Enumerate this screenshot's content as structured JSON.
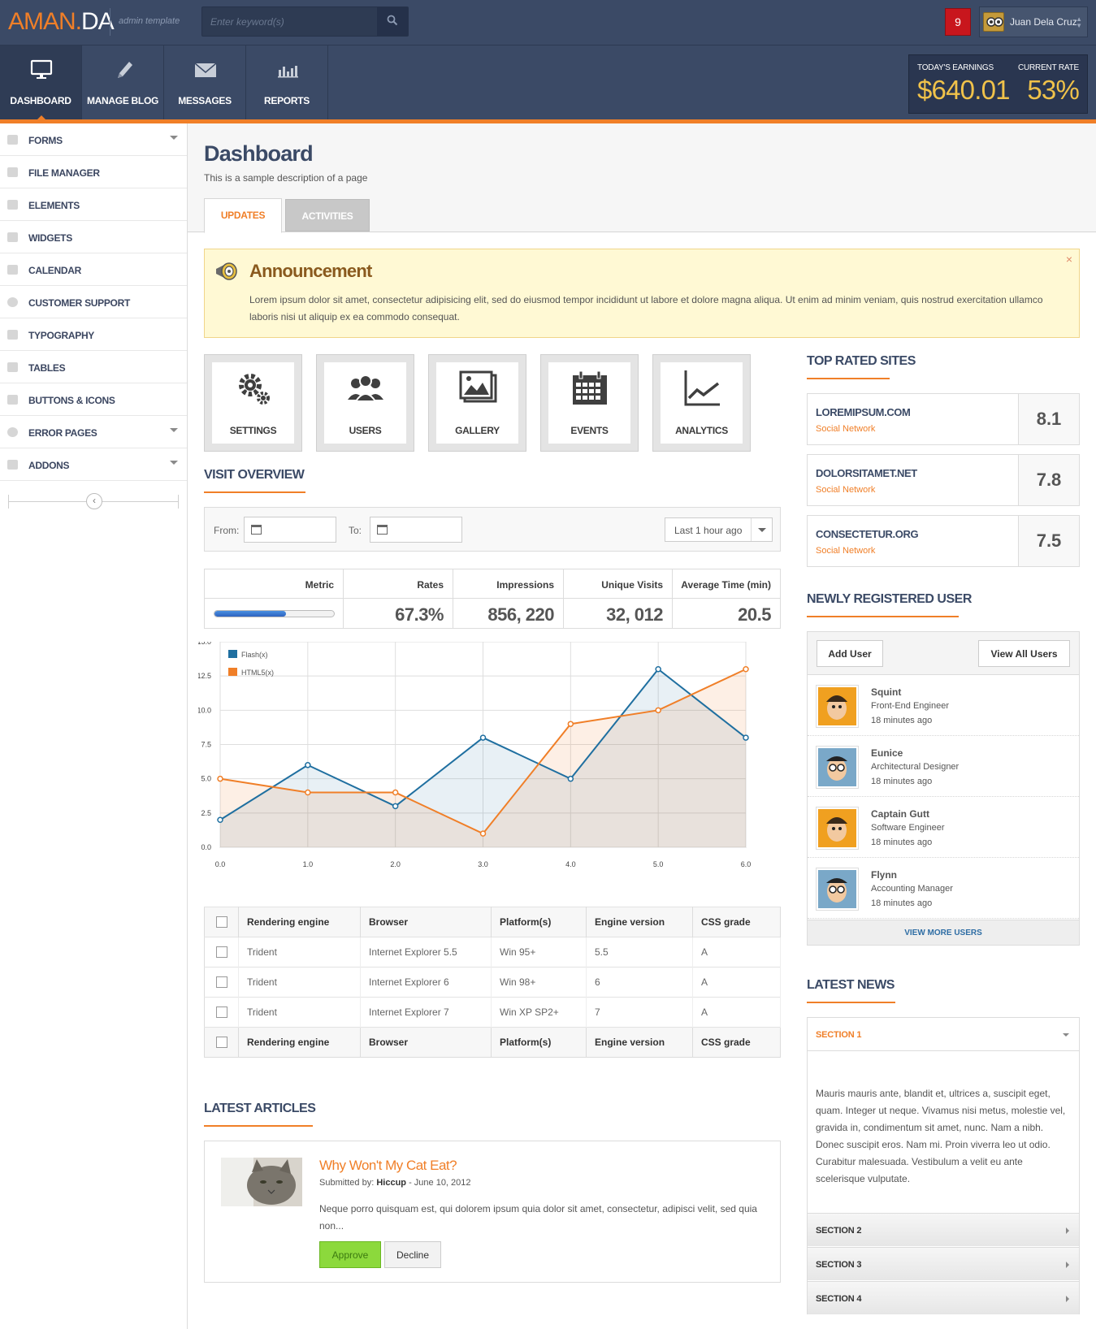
{
  "brand": {
    "name_a": "AMAN.",
    "name_b": "DA",
    "tagline": "admin template"
  },
  "search": {
    "placeholder": "Enter keyword(s)"
  },
  "header": {
    "notification_count": "9",
    "user_name": "Juan Dela Cruz"
  },
  "nav": [
    {
      "label": "DASHBOARD",
      "icon": "monitor-icon",
      "active": true
    },
    {
      "label": "MANAGE BLOG",
      "icon": "pencil-icon",
      "active": false
    },
    {
      "label": "MESSAGES",
      "icon": "envelope-icon",
      "active": false
    },
    {
      "label": "REPORTS",
      "icon": "bar-chart-icon",
      "active": false
    }
  ],
  "earnings": {
    "label": "TODAY'S EARNINGS",
    "value": "$640.01",
    "rate_label": "CURRENT RATE",
    "rate_value": "53%"
  },
  "sidebar": {
    "items": [
      {
        "label": "FORMS",
        "icon": "pencil-icon",
        "has_caret": true
      },
      {
        "label": "FILE MANAGER",
        "icon": "folder-icon",
        "has_caret": false
      },
      {
        "label": "ELEMENTS",
        "icon": "grid-icon",
        "has_caret": false
      },
      {
        "label": "WIDGETS",
        "icon": "widgets-icon",
        "has_caret": false
      },
      {
        "label": "CALENDAR",
        "icon": "calendar-icon",
        "has_caret": false
      },
      {
        "label": "CUSTOMER SUPPORT",
        "icon": "lifebuoy-icon",
        "has_caret": false
      },
      {
        "label": "TYPOGRAPHY",
        "icon": "brush-icon",
        "has_caret": false
      },
      {
        "label": "TABLES",
        "icon": "table-icon",
        "has_caret": false
      },
      {
        "label": "BUTTONS & ICONS",
        "icon": "pencil-icon",
        "has_caret": false
      },
      {
        "label": "ERROR PAGES",
        "icon": "no-entry-icon",
        "has_caret": true
      },
      {
        "label": "ADDONS",
        "icon": "box-icon",
        "has_caret": true
      }
    ],
    "collapse_glyph": "‹"
  },
  "page": {
    "title": "Dashboard",
    "description": "This is a sample description of a page"
  },
  "tabs": [
    {
      "label": "UPDATES",
      "active": true
    },
    {
      "label": "ACTIVITIES",
      "active": false
    }
  ],
  "announcement": {
    "title": "Announcement",
    "text": "Lorem ipsum dolor sit amet, consectetur adipisicing elit, sed do eiusmod tempor incididunt ut labore et dolore magna aliqua. Ut enim ad minim veniam, quis nostrud exercitation ullamco laboris nisi ut aliquip ex ea commodo consequat.",
    "close_glyph": "×"
  },
  "shortcuts": [
    {
      "label": "SETTINGS",
      "icon": "gears-icon"
    },
    {
      "label": "USERS",
      "icon": "users-icon"
    },
    {
      "label": "GALLERY",
      "icon": "gallery-icon"
    },
    {
      "label": "EVENTS",
      "icon": "calendar-icon"
    },
    {
      "label": "ANALYTICS",
      "icon": "line-chart-icon"
    }
  ],
  "visit_overview": {
    "heading": "VISIT OVERVIEW",
    "from_label": "From:",
    "to_label": "To:",
    "range_value": "Last 1 hour ago",
    "metrics": {
      "headers": [
        "Metric",
        "Rates",
        "Impressions",
        "Unique Visits",
        "Average Time (min)"
      ],
      "progress": 0.6,
      "values": [
        "67.3%",
        "856, 220",
        "32, 012",
        "20.5"
      ]
    }
  },
  "chart_data": {
    "type": "area",
    "x": [
      0,
      1,
      2,
      3,
      4,
      5,
      6
    ],
    "x_ticks": [
      "0.0",
      "1.0",
      "2.0",
      "3.0",
      "4.0",
      "5.0",
      "6.0"
    ],
    "y_ticks": [
      "0.0",
      "2.5",
      "5.0",
      "7.5",
      "10.0",
      "12.5",
      "15.0"
    ],
    "xlim": [
      0,
      6
    ],
    "ylim": [
      0,
      15
    ],
    "grid": true,
    "legend": "top-left",
    "series": [
      {
        "name": "Flash(x)",
        "color": "#1f6fa0",
        "values": [
          2,
          6,
          3,
          8,
          5,
          13,
          8
        ]
      },
      {
        "name": "HTML5(x)",
        "color": "#f07f28",
        "values": [
          5,
          4,
          4,
          1,
          9,
          10,
          13
        ]
      }
    ]
  },
  "data_table": {
    "headers": [
      "Rendering engine",
      "Browser",
      "Platform(s)",
      "Engine version",
      "CSS grade"
    ],
    "rows": [
      [
        "Trident",
        "Internet Explorer 5.5",
        "Win 95+",
        "5.5",
        "A"
      ],
      [
        "Trident",
        "Internet Explorer 6",
        "Win 98+",
        "6",
        "A"
      ],
      [
        "Trident",
        "Internet Explorer 7",
        "Win XP SP2+",
        "7",
        "A"
      ]
    ]
  },
  "articles": {
    "heading": "LATEST ARTICLES",
    "item": {
      "title": "Why Won't My Cat Eat?",
      "submitted_label": "Submitted by:",
      "author": "Hiccup",
      "date": " - June 10, 2012",
      "excerpt": "Neque porro quisquam est, qui dolorem ipsum quia dolor sit amet, consectetur, adipisci velit, sed quia non...",
      "approve_label": "Approve",
      "decline_label": "Decline"
    }
  },
  "top_rated": {
    "heading": "TOP RATED SITES",
    "sites": [
      {
        "name": "LOREMIPSUM.COM",
        "category": "Social Network",
        "score": "8.1"
      },
      {
        "name": "DOLORSITAMET.NET",
        "category": "Social Network",
        "score": "7.8"
      },
      {
        "name": "CONSECTETUR.ORG",
        "category": "Social Network",
        "score": "7.5"
      }
    ]
  },
  "new_users": {
    "heading": "NEWLY REGISTERED USER",
    "add_label": "Add User",
    "view_all_label": "View All Users",
    "view_more_label": "VIEW MORE USERS",
    "users": [
      {
        "name": "Squint",
        "role": "Front-End Engineer",
        "time": "18 minutes ago",
        "avatar_color": "#f0a020"
      },
      {
        "name": "Eunice",
        "role": "Architectural Designer",
        "time": "18 minutes ago",
        "avatar_color": "#7aa8c8"
      },
      {
        "name": "Captain Gutt",
        "role": "Software Engineer",
        "time": "18 minutes ago",
        "avatar_color": "#f0a020"
      },
      {
        "name": "Flynn",
        "role": "Accounting Manager",
        "time": "18 minutes ago",
        "avatar_color": "#7aa8c8"
      }
    ]
  },
  "news": {
    "heading": "LATEST NEWS",
    "sections": [
      "SECTION 1",
      "SECTION 2",
      "SECTION 3",
      "SECTION 4"
    ],
    "open_text": "Mauris mauris ante, blandit et, ultrices a, suscipit eget, quam. Integer ut neque. Vivamus nisi metus, molestie vel, gravida in, condimentum sit amet, nunc. Nam a nibh. Donec suscipit eros. Nam mi. Proin viverra leo ut odio. Curabitur malesuada. Vestibulum a velit eu ante scelerisque vulputate."
  },
  "colors": {
    "accent": "#f07f28",
    "header_bg": "#3b4a66",
    "earnings": "#f0c24a",
    "approve": "#8cd93c"
  }
}
